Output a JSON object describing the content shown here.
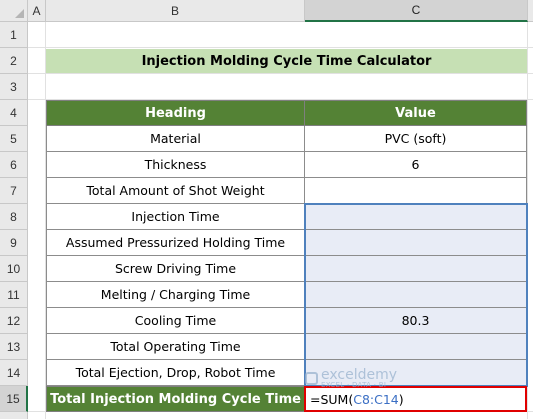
{
  "columns": {
    "a": "A",
    "b": "B",
    "c": "C"
  },
  "rows": [
    "1",
    "2",
    "3",
    "4",
    "5",
    "6",
    "7",
    "8",
    "9",
    "10",
    "11",
    "12",
    "13",
    "14",
    "15"
  ],
  "title": "Injection Molding Cycle Time Calculator",
  "table": {
    "headers": {
      "heading": "Heading",
      "value": "Value"
    },
    "items": [
      {
        "label": "Material",
        "value": "PVC (soft)"
      },
      {
        "label": "Thickness",
        "value": "6"
      },
      {
        "label": "Total Amount of Shot Weight",
        "value": ""
      },
      {
        "label": "Injection Time",
        "value": ""
      },
      {
        "label": "Assumed Pressurized Holding Time",
        "value": ""
      },
      {
        "label": "Screw Driving Time",
        "value": ""
      },
      {
        "label": "Melting / Charging Time",
        "value": ""
      },
      {
        "label": "Cooling Time",
        "value": "80.3"
      },
      {
        "label": "Total Operating Time",
        "value": ""
      },
      {
        "label": "Total Ejection, Drop, Robot Time",
        "value": ""
      }
    ],
    "total": {
      "label": "Total Injection Molding Cycle Time",
      "formula_prefix": "=SUM(",
      "formula_ref": "C8:C14",
      "formula_suffix": ")"
    }
  },
  "watermark": {
    "name": "exceldemy",
    "tagline": "EXCEL · DATA · BI"
  },
  "colors": {
    "header_green": "#548235",
    "title_green": "#c6e0b4",
    "active_red": "#e00000",
    "range_blue": "#4f81bd"
  }
}
